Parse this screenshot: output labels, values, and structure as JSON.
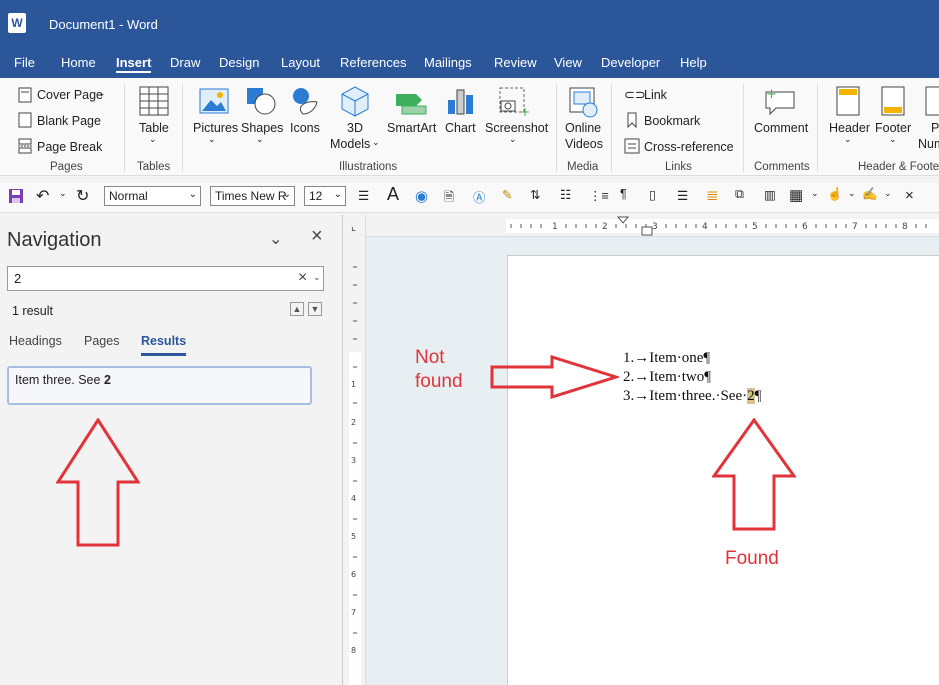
{
  "window": {
    "title": "Document1  -  Word",
    "logo": "W"
  },
  "menu": [
    "File",
    "Home",
    "Insert",
    "Draw",
    "Design",
    "Layout",
    "References",
    "Mailings",
    "Review",
    "View",
    "Developer",
    "Help"
  ],
  "ribbon": {
    "pages": {
      "cover": "Cover Page",
      "blank": "Blank Page",
      "break": "Page Break",
      "label": "Pages"
    },
    "tables": {
      "table": "Table",
      "label": "Tables"
    },
    "illustrations": {
      "pictures": "Pictures",
      "shapes": "Shapes",
      "icons": "Icons",
      "models_line1": "3D",
      "models_line2": "Models",
      "smartart": "SmartArt",
      "chart": "Chart",
      "screenshot": "Screenshot",
      "label": "Illustrations"
    },
    "media": {
      "line1": "Online",
      "line2": "Videos",
      "label": "Media"
    },
    "links": {
      "link": "Link",
      "bookmark": "Bookmark",
      "crossref": "Cross-reference",
      "label": "Links"
    },
    "comments": {
      "comment": "Comment",
      "label": "Comments"
    },
    "header_footer": {
      "header": "Header",
      "footer": "Footer",
      "pagenum_line1": "P",
      "pagenum_line2": "Num",
      "label": "Header & Foote"
    }
  },
  "qat": {
    "style": "Normal",
    "font": "Times New R",
    "size": "12"
  },
  "navigation": {
    "title": "Navigation",
    "search_value": "2",
    "result_count": "1 result",
    "tabs": [
      "Headings",
      "Pages",
      "Results"
    ],
    "result_text": "Item three. See ",
    "result_match": "2"
  },
  "document": {
    "lines": [
      {
        "prefix": "1.→Item·one¶"
      },
      {
        "prefix": "2.→Item·two¶"
      },
      {
        "prefix": "3.→Item·three.·See·",
        "match": "2",
        "suffix": "¶"
      }
    ]
  },
  "annotations": {
    "not_found_1": "Not",
    "not_found_2": "found",
    "found": "Found"
  },
  "colors": {
    "accent": "#2b579a",
    "annotation": "#e0333a",
    "highlight": "#d8c48a"
  },
  "icons": [
    "save-icon",
    "undo-icon",
    "redo-icon",
    "close-icon",
    "chevron-down-icon",
    "search-clear-icon"
  ]
}
